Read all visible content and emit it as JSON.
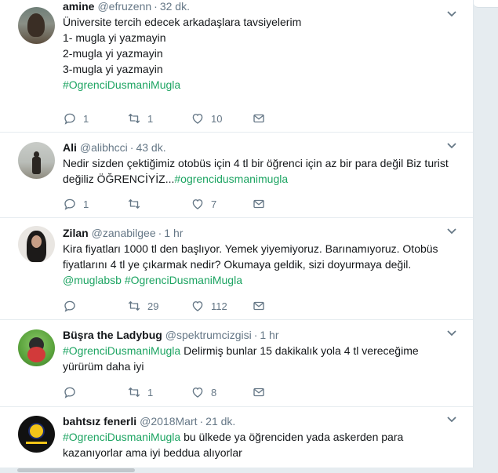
{
  "colors": {
    "hashtag": "#1da462",
    "text": "#14171a",
    "muted": "#657786"
  },
  "tweets": [
    {
      "name": "amine",
      "handle": "@efruzenn",
      "time": "32 dk.",
      "lines": [
        "Üniversite tercih edecek arkadaşlara tavsiyelerim",
        "1- mugla yi yazmayin",
        "2-mugla yi yazmayin",
        "3-mugla yi yazmayin"
      ],
      "hashtag": "#OgrenciDusmaniMugla",
      "replies": "1",
      "retweets": "1",
      "likes": "10"
    },
    {
      "name": "Ali",
      "handle": "@alibhcci",
      "time": "43 dk.",
      "line1": "Nedir sizden çektiğimiz otobüs için  4 tl bir öğrenci için az bir para değil Biz turist",
      "line2_text": "değiliz ÖĞRENCİYİZ...",
      "hashtag": "#ogrencidusmanimugla",
      "replies": "1",
      "retweets": "",
      "likes": "7"
    },
    {
      "name": "Zilan",
      "handle": "@zanabilgee",
      "time": "1 hr",
      "line1": "Kira fiyatları 1000 tl den başlıyor. Yemek yiyemiyoruz. Barınamıyoruz. Otobüs",
      "line2": "fiyatlarını 4 tl ye çıkarmak nedir? Okumaya geldik, sizi doyurmaya değil.",
      "mention": "@muglabsb",
      "hashtag": "#OgrenciDusmaniMugla",
      "replies": "",
      "retweets": "29",
      "likes": "112"
    },
    {
      "name": "Büşra the Ladybug",
      "handle": "@spektrumcizgisi",
      "time": "1 hr",
      "hashtag": "#OgrenciDusmaniMugla",
      "line1_rest": " Delirmiş bunlar 15 dakikalık yola 4 tl vereceğime",
      "line2": "yürürüm daha iyi",
      "replies": "",
      "retweets": "1",
      "likes": "8"
    },
    {
      "name": "bahtsız fenerli",
      "handle": "@2018Mart",
      "time": "21 dk.",
      "hashtag": "#OgrenciDusmaniMugla",
      "line1_rest": " bu ülkede ya öğrenciden yada askerden para",
      "line2": "kazanıyorlar ama iyi beddua alıyorlar"
    }
  ],
  "icons": [
    "reply-icon",
    "retweet-icon",
    "like-icon",
    "message-icon",
    "chevron-down-icon"
  ]
}
